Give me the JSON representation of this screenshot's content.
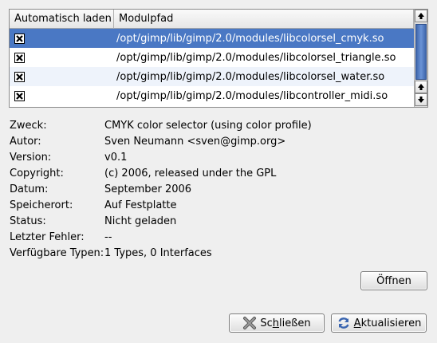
{
  "table": {
    "headers": [
      "Automatisch laden",
      "Modulpfad"
    ],
    "rows": [
      {
        "checked": true,
        "path": "/opt/gimp/lib/gimp/2.0/modules/libcolorsel_cmyk.so",
        "selected": true
      },
      {
        "checked": true,
        "path": "/opt/gimp/lib/gimp/2.0/modules/libcolorsel_triangle.so",
        "selected": false
      },
      {
        "checked": true,
        "path": "/opt/gimp/lib/gimp/2.0/modules/libcolorsel_water.so",
        "selected": false
      },
      {
        "checked": true,
        "path": "/opt/gimp/lib/gimp/2.0/modules/libcontroller_midi.so",
        "selected": false
      }
    ]
  },
  "info": [
    {
      "label": "Zweck:",
      "value": "CMYK color selector (using color profile)"
    },
    {
      "label": "Autor:",
      "value": "Sven Neumann <sven@gimp.org>"
    },
    {
      "label": "Version:",
      "value": "v0.1"
    },
    {
      "label": "Copyright:",
      "value": "(c) 2006, released under the GPL"
    },
    {
      "label": "Datum:",
      "value": "September 2006"
    },
    {
      "label": "Speicherort:",
      "value": "Auf Festplatte"
    },
    {
      "label": "Status:",
      "value": "Nicht geladen"
    },
    {
      "label": "Letzter Fehler:",
      "value": "--"
    },
    {
      "label": "Verfügbare Typen:",
      "value": "1 Types, 0 Interfaces"
    }
  ],
  "buttons": {
    "open_label": "Öffnen",
    "close_label_pre": "Sc",
    "close_label_mnemonic": "h",
    "close_label_post": "ließen",
    "refresh_label_pre": "",
    "refresh_label_mnemonic": "A",
    "refresh_label_post": "ktualisieren"
  },
  "icons": {
    "close": "close-x-icon",
    "refresh": "refresh-icon",
    "scroll_up": "arrow-up-icon",
    "scroll_down": "arrow-down-icon"
  },
  "colors": {
    "selection": "#4a78c4",
    "alt_row": "#eef3fb",
    "thumb": "#4a78c4"
  }
}
